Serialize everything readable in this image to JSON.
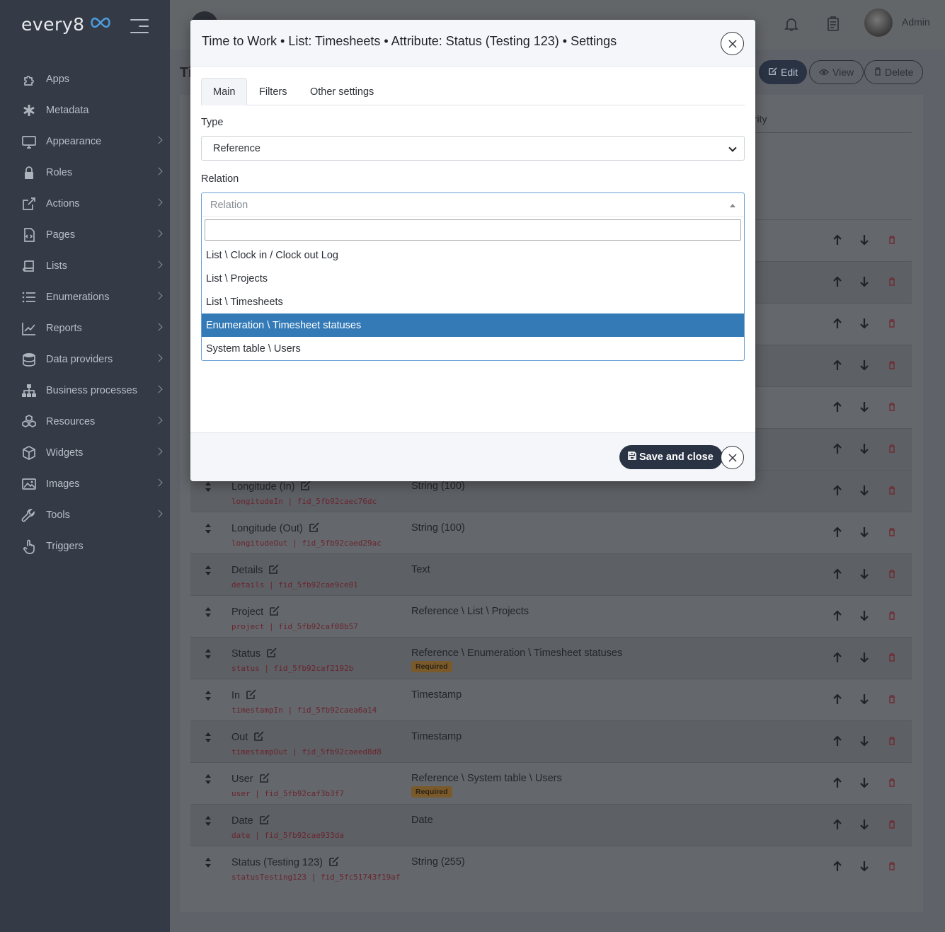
{
  "brand": {
    "logo_text": "every8"
  },
  "sidebar": {
    "items": [
      {
        "label": "Apps",
        "icon": "puzzle-icon",
        "has_children": false
      },
      {
        "label": "Metadata",
        "icon": "asterisk-icon",
        "has_children": false
      },
      {
        "label": "Appearance",
        "icon": "monitor-icon",
        "has_children": true
      },
      {
        "label": "Roles",
        "icon": "lock-icon",
        "has_children": true
      },
      {
        "label": "Actions",
        "icon": "external-link-icon",
        "has_children": true
      },
      {
        "label": "Pages",
        "icon": "code-file-icon",
        "has_children": true
      },
      {
        "label": "Lists",
        "icon": "book-icon",
        "has_children": true
      },
      {
        "label": "Enumerations",
        "icon": "list-icon",
        "has_children": true
      },
      {
        "label": "Reports",
        "icon": "chart-line-icon",
        "has_children": true
      },
      {
        "label": "Data providers",
        "icon": "database-icon",
        "has_children": true
      },
      {
        "label": "Business processes",
        "icon": "sitemap-icon",
        "has_children": true
      },
      {
        "label": "Resources",
        "icon": "cubes-icon",
        "has_children": true
      },
      {
        "label": "Widgets",
        "icon": "cube-icon",
        "has_children": true
      },
      {
        "label": "Images",
        "icon": "image-icon",
        "has_children": true
      },
      {
        "label": "Tools",
        "icon": "wrench-icon",
        "has_children": true
      },
      {
        "label": "Triggers",
        "icon": "hand-pointer-icon",
        "has_children": false
      }
    ]
  },
  "topbar": {
    "user_label": "Admin"
  },
  "page": {
    "title_partial": "Ti",
    "buttons": {
      "edit": "Edit",
      "view": "View",
      "delete": "Delete"
    },
    "column_partial": "curity"
  },
  "attributes": [
    {
      "name": "Longitude (In)",
      "code": "longitudeIn | fid_5fb92caec76dc",
      "type": "String (100)",
      "required": false
    },
    {
      "name": "Longitude (Out)",
      "code": "longitudeOut | fid_5fb92caed29ac",
      "type": "String (100)",
      "required": false
    },
    {
      "name": "Details",
      "code": "details | fid_5fb92cae9ce01",
      "type": "Text",
      "required": false
    },
    {
      "name": "Project",
      "code": "project | fid_5fb92caf08b57",
      "type": "Reference \\ List \\ Projects",
      "required": false
    },
    {
      "name": "Status",
      "code": "status | fid_5fb92caf2192b",
      "type": "Reference \\ Enumeration \\ Timesheet statuses",
      "required": true
    },
    {
      "name": "In",
      "code": "timestampIn | fid_5fb92caea6a14",
      "type": "Timestamp",
      "required": false
    },
    {
      "name": "Out",
      "code": "timestampOut | fid_5fb92caeed8d8",
      "type": "Timestamp",
      "required": false
    },
    {
      "name": "User",
      "code": "user | fid_5fb92caf3b3f7",
      "type": "Reference \\ System table \\ Users",
      "required": true
    },
    {
      "name": "Date",
      "code": "date | fid_5fb92cae933da",
      "type": "Date",
      "required": false
    },
    {
      "name": "Status (Testing 123)",
      "code": "statusTesting123 | fid_5fc51743f19af",
      "type": "String (255)",
      "required": false
    }
  ],
  "required_badge": "Required",
  "modal": {
    "title": "Time to Work • List: Timesheets • Attribute: Status (Testing 123) • Settings",
    "tabs": [
      "Main",
      "Filters",
      "Other settings"
    ],
    "type_label": "Type",
    "type_value": "Reference",
    "relation_label": "Relation",
    "relation_placeholder": "Relation",
    "relation_search_value": "",
    "relation_options": [
      "List \\ Clock in / Clock out Log",
      "List \\ Projects",
      "List \\ Timesheets",
      "Enumeration \\ Timesheet statuses",
      "System table \\ Users"
    ],
    "highlighted_option_index": 3,
    "save_label": "Save and close"
  },
  "colors": {
    "sidebar_bg": "#343a46",
    "accent_dark": "#2a3344",
    "highlight": "#337ab7",
    "required_badge": "#e8a33d"
  }
}
